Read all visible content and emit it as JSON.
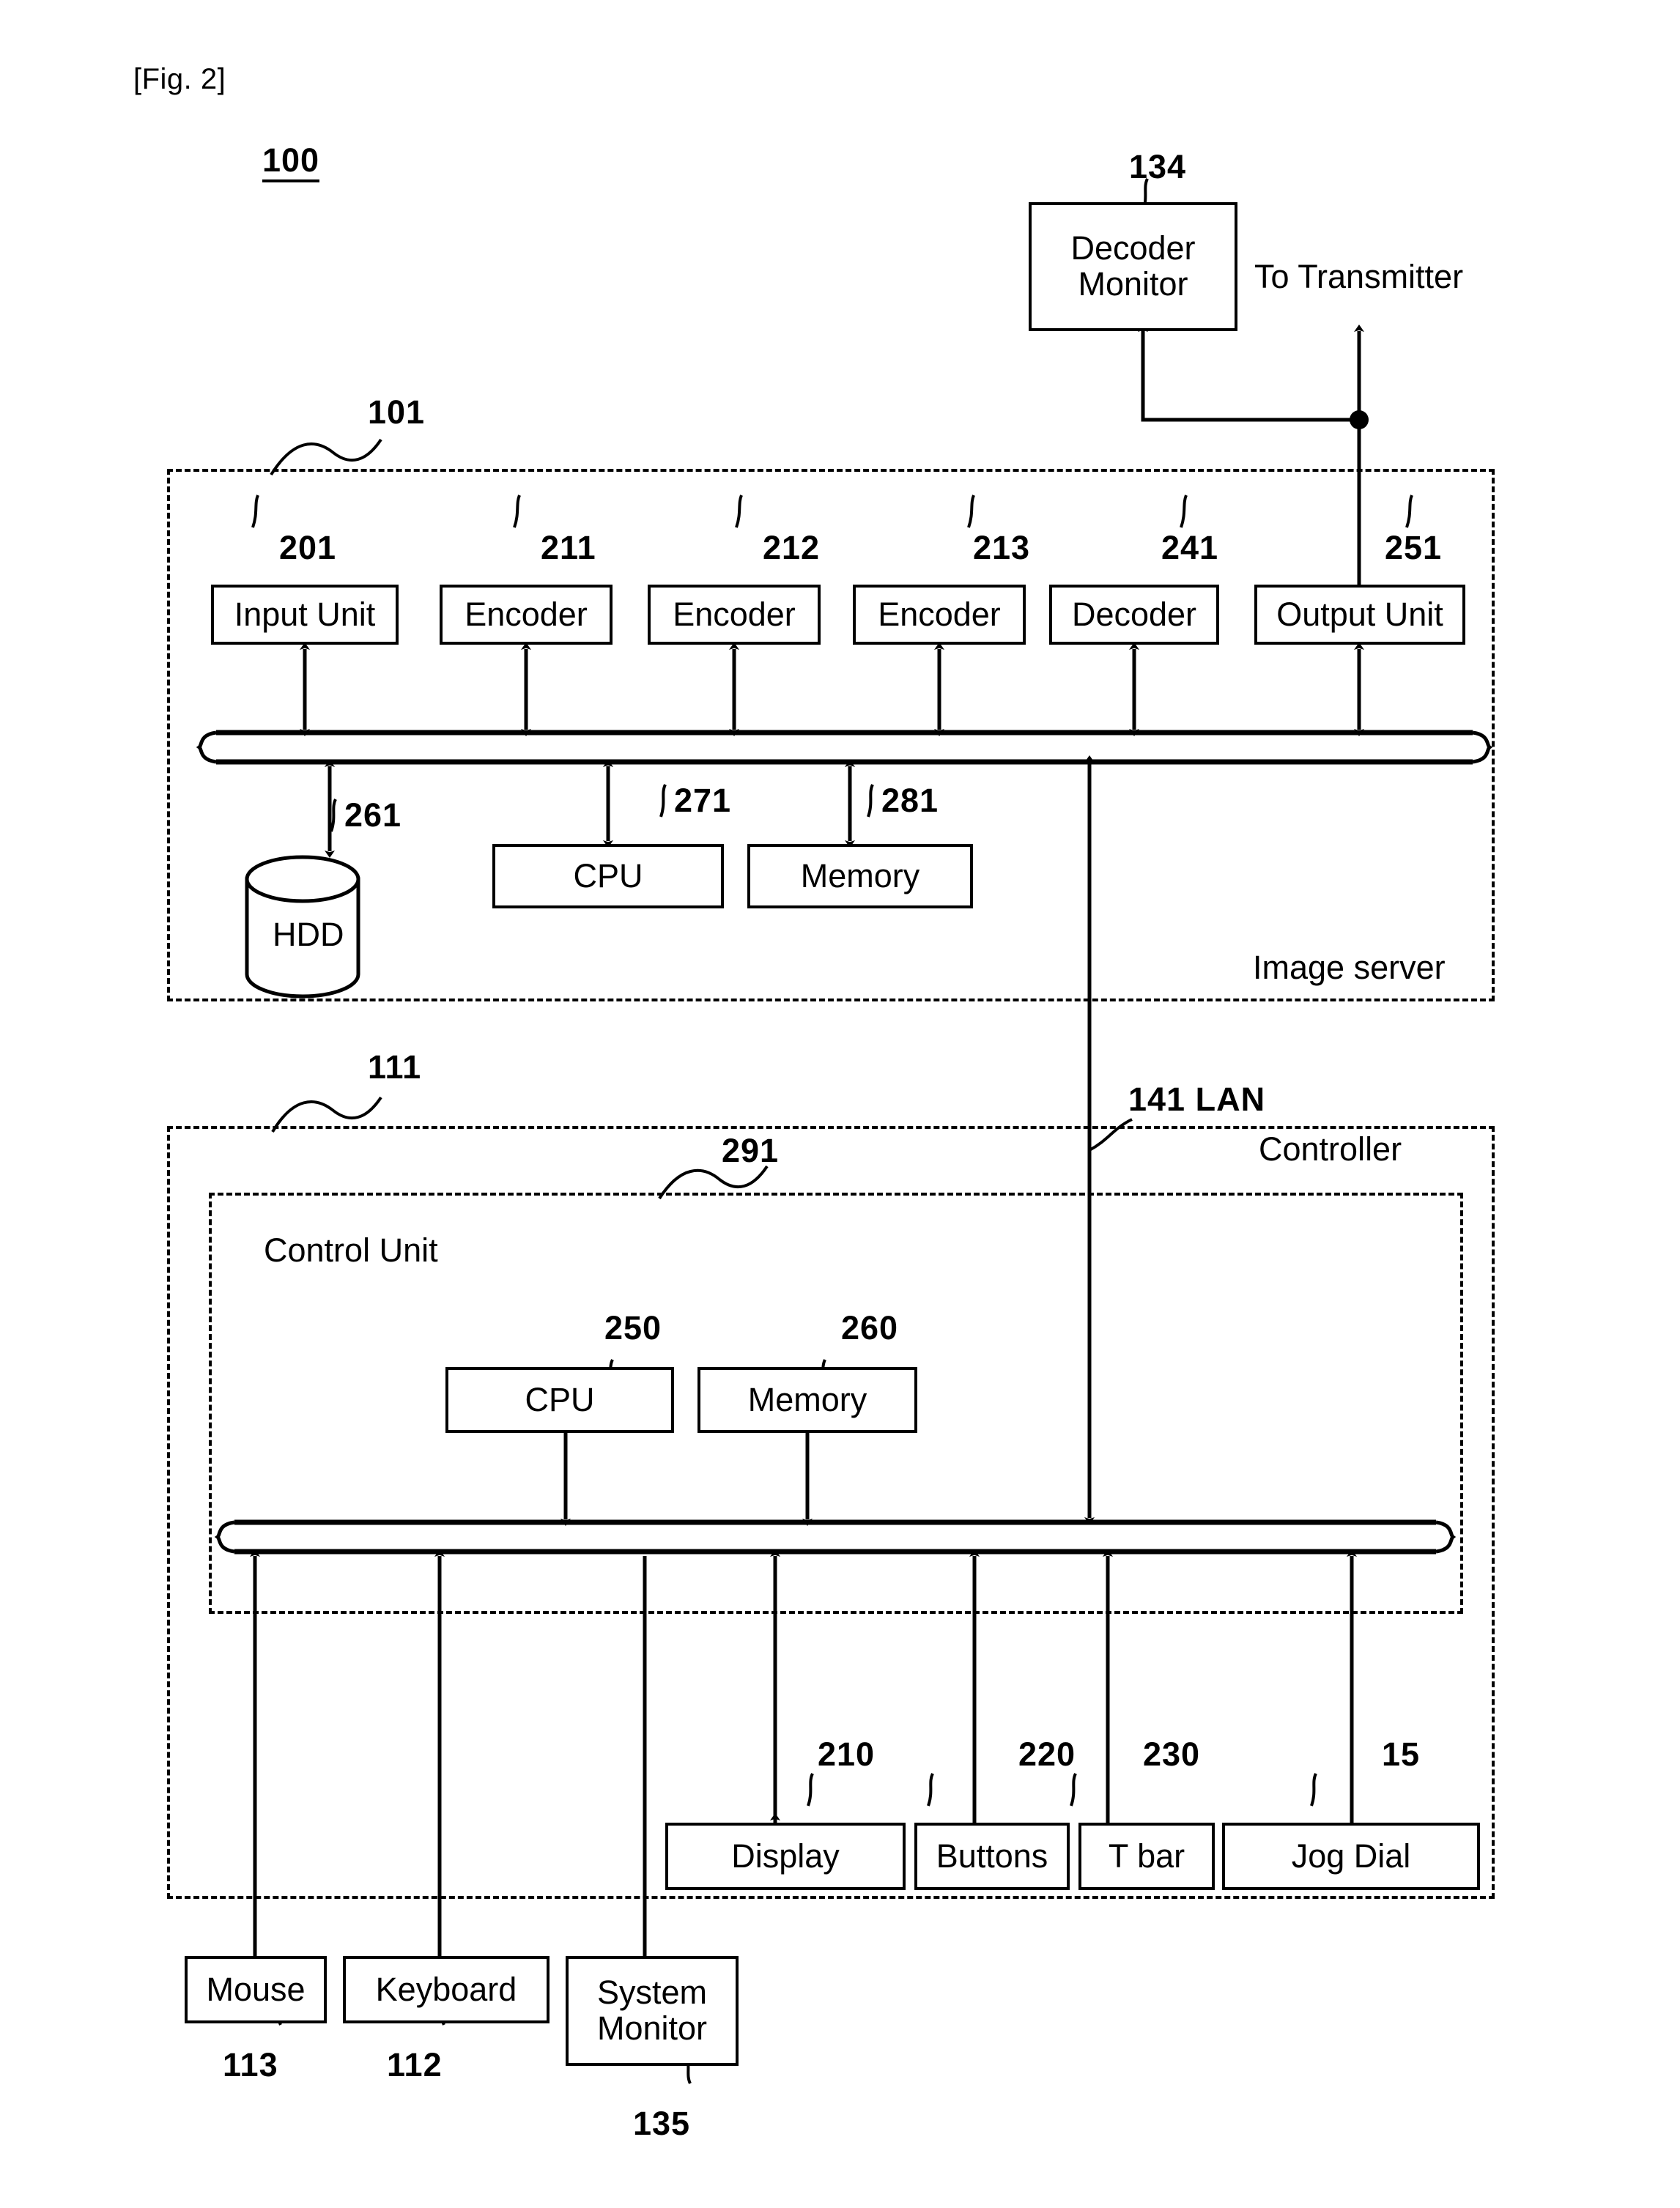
{
  "figure": {
    "tag": "[Fig. 2]",
    "system_number": "100"
  },
  "external": {
    "decoder_monitor": {
      "label": "Decoder\nMonitor",
      "ref": "134"
    },
    "to_transmitter": {
      "label": "To Transmitter"
    },
    "mouse": {
      "label": "Mouse",
      "ref": "113"
    },
    "keyboard": {
      "label": "Keyboard",
      "ref": "112"
    },
    "system_monitor": {
      "label": "System\nMonitor",
      "ref": "135"
    }
  },
  "image_server": {
    "title": "Image server",
    "ref": "101",
    "top_row": [
      {
        "label": "Input Unit",
        "ref": "201"
      },
      {
        "label": "Encoder",
        "ref": "211"
      },
      {
        "label": "Encoder",
        "ref": "212"
      },
      {
        "label": "Encoder",
        "ref": "213"
      },
      {
        "label": "Decoder",
        "ref": "241"
      },
      {
        "label": "Output Unit",
        "ref": "251"
      }
    ],
    "bottom_row": [
      {
        "label": "HDD",
        "ref": "261"
      },
      {
        "label": "CPU",
        "ref": "271"
      },
      {
        "label": "Memory",
        "ref": "281"
      }
    ]
  },
  "lan": {
    "label": "141 LAN"
  },
  "controller": {
    "title": "Controller",
    "ref": "111",
    "control_unit": {
      "title": "Control Unit",
      "ref": "291",
      "components": [
        {
          "label": "CPU",
          "ref": "250"
        },
        {
          "label": "Memory",
          "ref": "260"
        }
      ]
    },
    "peripherals": [
      {
        "label": "Display",
        "ref": "210"
      },
      {
        "label": "Buttons",
        "ref": "220"
      },
      {
        "label": "T bar",
        "ref": "230"
      },
      {
        "label": "Jog Dial",
        "ref": "15"
      }
    ]
  }
}
